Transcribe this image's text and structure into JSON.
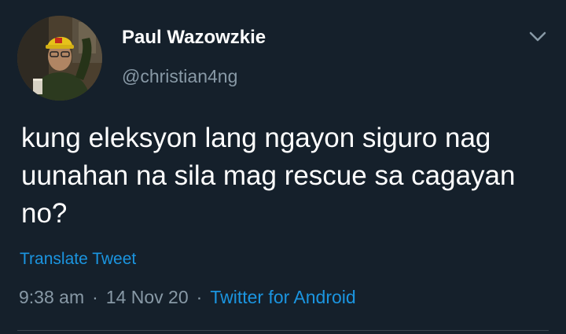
{
  "tweet": {
    "author": {
      "display_name": "Paul Wazowzkie",
      "handle": "@christian4ng",
      "avatar_icon": "avatar-photo"
    },
    "text": "kung eleksyon lang ngayon siguro nag\nuunahan na sila mag rescue sa cagayan\nno?",
    "translate_label": "Translate Tweet",
    "time": "9:38 am",
    "separator": "·",
    "date": "14 Nov 20",
    "source": "Twitter for Android",
    "menu_icon": "chevron-down-icon"
  },
  "colors": {
    "background": "#15202b",
    "primary_text": "#ffffff",
    "secondary_text": "#8899a6",
    "link": "#1b95e0"
  }
}
